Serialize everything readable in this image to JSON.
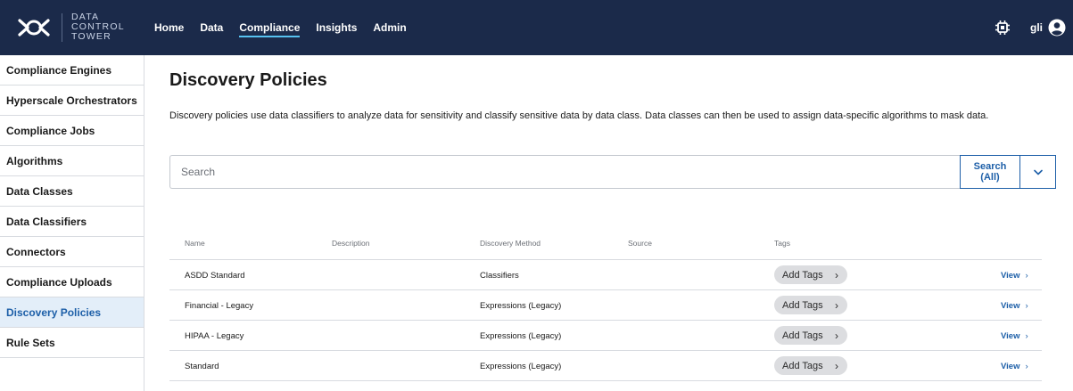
{
  "brand": {
    "line1": "DATA",
    "line2": "CONTROL",
    "line3": "TOWER"
  },
  "nav": [
    {
      "label": "Home"
    },
    {
      "label": "Data"
    },
    {
      "label": "Compliance"
    },
    {
      "label": "Insights"
    },
    {
      "label": "Admin"
    }
  ],
  "nav_active": "Compliance",
  "user": {
    "name": "gli"
  },
  "sidebar": {
    "items": [
      {
        "label": "Compliance Engines"
      },
      {
        "label": "Hyperscale Orchestrators"
      },
      {
        "label": "Compliance Jobs"
      },
      {
        "label": "Algorithms"
      },
      {
        "label": "Data Classes"
      },
      {
        "label": "Data Classifiers"
      },
      {
        "label": "Connectors"
      },
      {
        "label": "Compliance Uploads"
      },
      {
        "label": "Discovery Policies"
      },
      {
        "label": "Rule Sets"
      }
    ],
    "active": "Discovery Policies"
  },
  "page": {
    "title": "Discovery Policies",
    "description": "Discovery policies use data classifiers to analyze data for sensitivity and classify sensitive data by data class. Data classes can then be used to assign data-specific algorithms to mask data."
  },
  "search": {
    "placeholder": "Search",
    "value": "",
    "button_line1": "Search",
    "button_line2": "(All)"
  },
  "table": {
    "columns": {
      "name": "Name",
      "description": "Description",
      "method": "Discovery Method",
      "source": "Source",
      "tags": "Tags"
    },
    "rows": [
      {
        "name": "ASDD Standard",
        "description": "",
        "method": "Classifiers",
        "source": "",
        "tags_label": "Add Tags",
        "view_label": "View"
      },
      {
        "name": "Financial - Legacy",
        "description": "",
        "method": "Expressions (Legacy)",
        "source": "",
        "tags_label": "Add Tags",
        "view_label": "View"
      },
      {
        "name": "HIPAA - Legacy",
        "description": "",
        "method": "Expressions (Legacy)",
        "source": "",
        "tags_label": "Add Tags",
        "view_label": "View"
      },
      {
        "name": "Standard",
        "description": "",
        "method": "Expressions (Legacy)",
        "source": "",
        "tags_label": "Add Tags",
        "view_label": "View"
      }
    ]
  },
  "colors": {
    "topbar": "#1b2a4a",
    "accent": "#1d5fa8",
    "nav_underline": "#57c2f0",
    "sidebar_active_bg": "#e3eef9"
  }
}
